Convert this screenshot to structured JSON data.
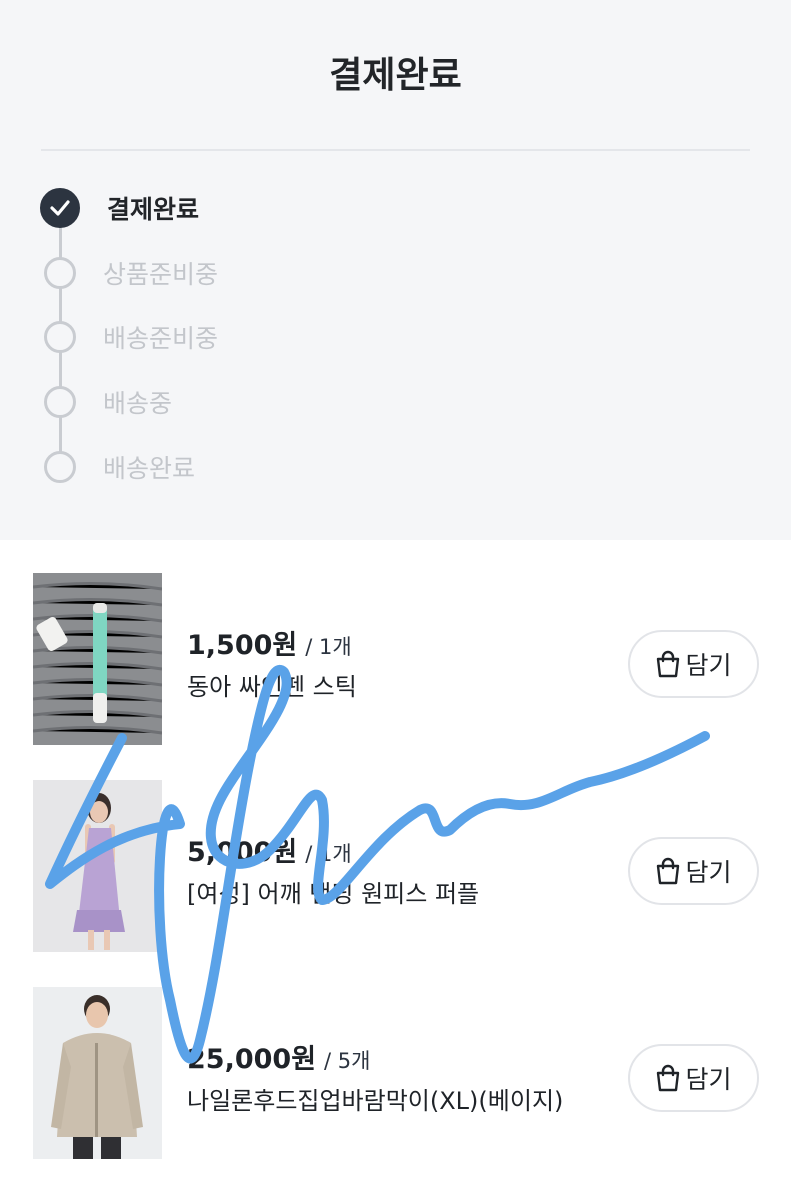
{
  "header": {
    "title": "결제완료"
  },
  "status_steps": [
    {
      "label": "결제완료",
      "state": "done",
      "icon": "check-icon"
    },
    {
      "label": "상품준비중",
      "state": "pending"
    },
    {
      "label": "배송준비중",
      "state": "pending"
    },
    {
      "label": "배송중",
      "state": "pending"
    },
    {
      "label": "배송완료",
      "state": "pending"
    }
  ],
  "products": [
    {
      "price": "1,500원",
      "qty": "/ 1개",
      "name": "동아 싸인펜 스틱",
      "cart_label": "담기",
      "cart_icon": "shopping-bag-icon"
    },
    {
      "price": "5,000원",
      "qty": "/ 1개",
      "name": "[여성] 어깨 밴딩 원피스 퍼플",
      "cart_label": "담기",
      "cart_icon": "shopping-bag-icon"
    },
    {
      "price": "25,000원",
      "qty": "/ 5개",
      "name": "나일론후드집업바람막이(XL)(베이지)",
      "cart_label": "담기",
      "cart_icon": "shopping-bag-icon"
    }
  ],
  "colors": {
    "done": "#2c3440",
    "pending": "#c9ccd1",
    "scribble": "#5aa2e8",
    "background_top": "#f5f6f8"
  }
}
